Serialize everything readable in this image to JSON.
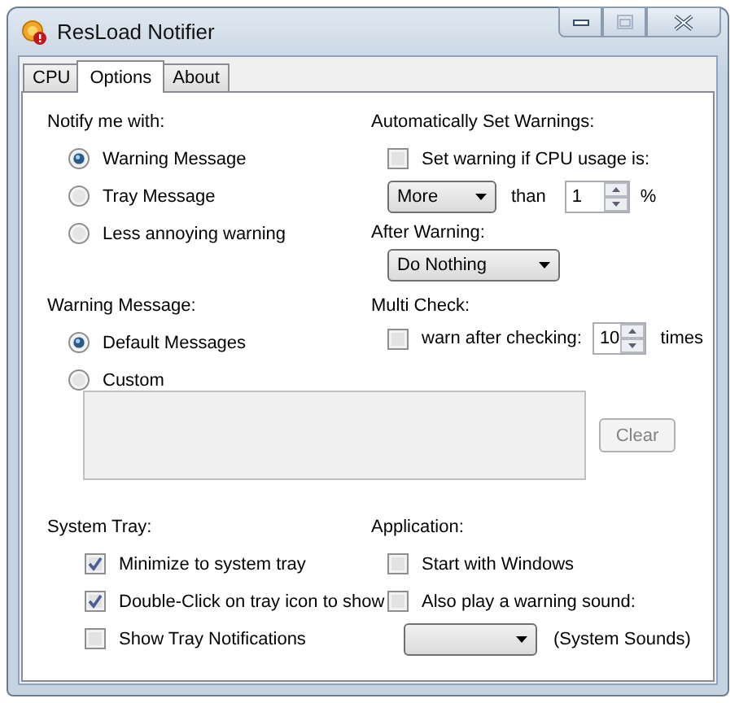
{
  "window": {
    "title": "ResLoad Notifier"
  },
  "tabs": [
    {
      "label": "CPU",
      "selected": false
    },
    {
      "label": "Options",
      "selected": true
    },
    {
      "label": "About",
      "selected": false
    }
  ],
  "notify": {
    "label": "Notify me with:",
    "options": [
      {
        "label": "Warning Message",
        "selected": true
      },
      {
        "label": "Tray Message",
        "selected": false
      },
      {
        "label": "Less annoying warning",
        "selected": false
      }
    ]
  },
  "auto_warnings": {
    "label": "Automatically Set Warnings:",
    "checkbox": {
      "label": "Set warning if CPU usage is:",
      "checked": false
    },
    "comparison": "More",
    "than_label": "than",
    "threshold": "1",
    "unit": "%"
  },
  "after_warning": {
    "label": "After Warning:",
    "value": "Do Nothing"
  },
  "warning_message": {
    "label": "Warning Message:",
    "options": [
      {
        "label": "Default Messages",
        "selected": true
      },
      {
        "label": "Custom",
        "selected": false
      }
    ],
    "clear_button": {
      "label": "Clear",
      "disabled": true
    }
  },
  "multi_check": {
    "label": "Multi Check:",
    "checkbox": {
      "label": "warn after checking:",
      "checked": false
    },
    "count": "10",
    "unit": "times"
  },
  "system_tray": {
    "label": "System Tray:",
    "options": [
      {
        "label": "Minimize to system tray",
        "checked": true
      },
      {
        "label": "Double-Click on tray icon to show",
        "checked": true
      },
      {
        "label": "Show Tray Notifications",
        "checked": false
      }
    ]
  },
  "application": {
    "label": "Application:",
    "options": [
      {
        "label": "Start with Windows",
        "checked": false
      },
      {
        "label": "Also play a warning sound:",
        "checked": false
      }
    ],
    "sound_note": "(System Sounds)"
  }
}
